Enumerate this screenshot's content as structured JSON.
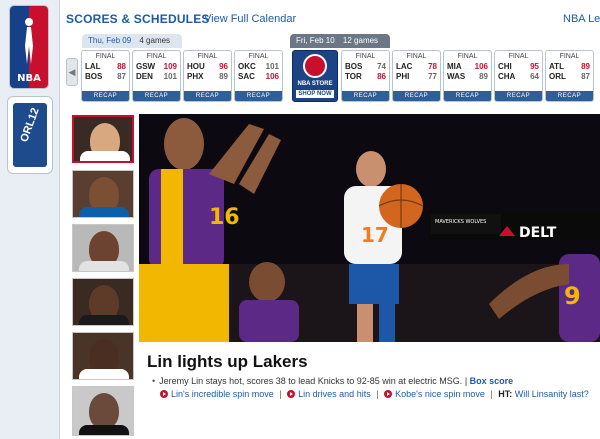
{
  "header": {
    "title": "SCORES & SCHEDULES",
    "calendar_link": "View Full Calendar",
    "league_link": "NBA Lea"
  },
  "left_rail": {
    "nba_logo_text": "NBA",
    "asg_logo_text": "ORL12"
  },
  "tabs": [
    {
      "day": "Thu, Feb 09",
      "count": "4 games"
    },
    {
      "day": "Fri, Feb 10",
      "count": "12 games"
    }
  ],
  "thursday_games": [
    {
      "status": "FINAL",
      "away": "LAL",
      "away_pts": "88",
      "home": "BOS",
      "home_pts": "87",
      "recap": "RECAP",
      "away_win": true
    },
    {
      "status": "FINAL",
      "away": "GSW",
      "away_pts": "109",
      "home": "DEN",
      "home_pts": "101",
      "recap": "RECAP",
      "away_win": true
    },
    {
      "status": "FINAL",
      "away": "HOU",
      "away_pts": "96",
      "home": "PHX",
      "home_pts": "89",
      "recap": "RECAP",
      "away_win": true
    },
    {
      "status": "FINAL",
      "away": "OKC",
      "away_pts": "101",
      "home": "SAC",
      "home_pts": "106",
      "recap": "RECAP",
      "away_win": false
    }
  ],
  "store": {
    "line1": "NBA STORE",
    "line2": "SHOP NOW"
  },
  "friday_games": [
    {
      "status": "FINAL",
      "away": "BOS",
      "away_pts": "74",
      "home": "TOR",
      "home_pts": "86",
      "recap": "RECAP",
      "away_win": false
    },
    {
      "status": "FINAL",
      "away": "LAC",
      "away_pts": "78",
      "home": "PHI",
      "home_pts": "77",
      "recap": "RECAP",
      "away_win": true
    },
    {
      "status": "FINAL",
      "away": "MIA",
      "away_pts": "106",
      "home": "WAS",
      "home_pts": "89",
      "recap": "RECAP",
      "away_win": true
    },
    {
      "status": "FINAL",
      "away": "CHI",
      "away_pts": "95",
      "home": "CHA",
      "home_pts": "64",
      "recap": "RECAP",
      "away_win": true
    },
    {
      "status": "FINAL",
      "away": "ATL",
      "away_pts": "89",
      "home": "ORL",
      "home_pts": "87",
      "recap": "RECAP",
      "away_win": true
    }
  ],
  "hero": {
    "scoreboard": "MAVERICKS  WOLVES",
    "sponsor": "DELT",
    "jersey_lakers": "16",
    "jersey_knicks": "17",
    "jersey_right": "9"
  },
  "story": {
    "headline": "Lin lights up Lakers",
    "dek": "Jeremy Lin stays hot, scores 38 to lead Knicks to 92-85 win at electric MSG.",
    "box_score": "Box score",
    "links": [
      "Lin's incredible spin move",
      "Lin drives and hits",
      "Kobe's nice spin move"
    ],
    "ht_label": "HT:",
    "ht_link": "Will Linsanity last?"
  },
  "colors": {
    "brand_blue": "#1e5aa6",
    "accent_red": "#c8102e",
    "recap_bar": "#2f5f98"
  }
}
